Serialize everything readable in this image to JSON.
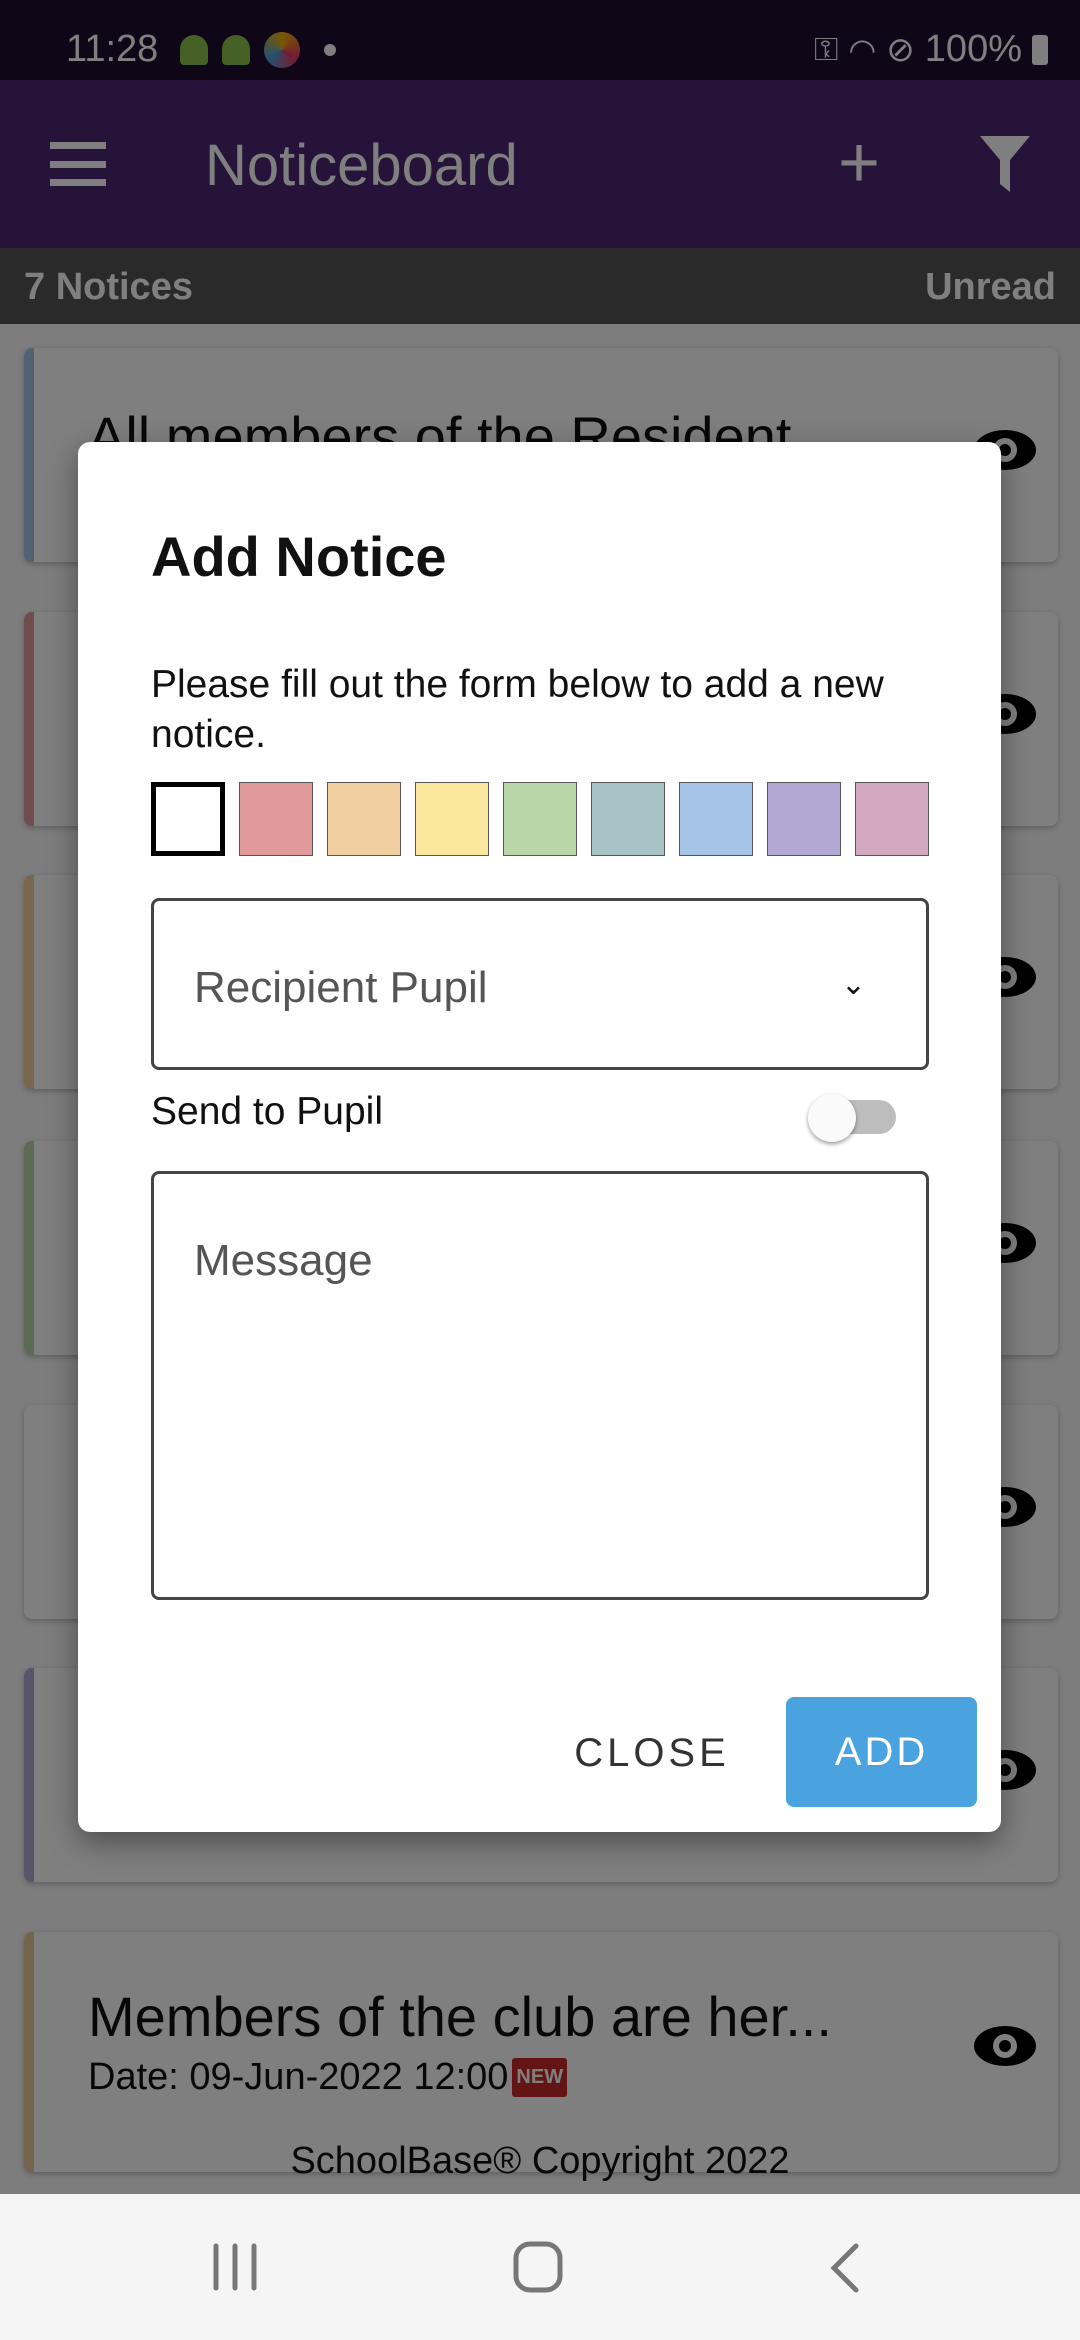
{
  "status_bar": {
    "time": "11:28",
    "battery": "100%"
  },
  "app_bar": {
    "title": "Noticeboard",
    "menu_icon": "hamburger-icon",
    "add_icon": "plus-icon",
    "filter_icon": "filter-icon",
    "color": "#4a2775"
  },
  "summary": {
    "count": "7 Notices",
    "filter": "Unread"
  },
  "notices": [
    {
      "title": "All members of the Resident",
      "color": "#a6c4e6"
    },
    {
      "title": "",
      "color": "#e09a9a"
    },
    {
      "title": "",
      "color": "#f2cfa0"
    },
    {
      "title": "",
      "color": "#b9d6a8"
    },
    {
      "title": "",
      "color": "#ffffff"
    },
    {
      "title": "",
      "color": "#b3a8d4"
    },
    {
      "title": "Members of the club are her...",
      "date": "Date: 09-Jun-2022 12:00",
      "badge": "NEW",
      "color": "#e8c898"
    }
  ],
  "footer": "SchoolBase® Copyright 2022",
  "dialog": {
    "title": "Add Notice",
    "description": "Please fill out the form below to add a new notice.",
    "colors": [
      "#ffffff",
      "#e09a9a",
      "#f2cfa0",
      "#fbe79e",
      "#b9d6a8",
      "#a8c3c6",
      "#a6c4e6",
      "#b3a8d4",
      "#d2a8c0"
    ],
    "selected_color": "#ffffff",
    "recipient_placeholder": "Recipient Pupil",
    "send_to_pupil_label": "Send to Pupil",
    "send_to_pupil": false,
    "message_placeholder": "Message",
    "close_label": "CLOSE",
    "add_label": "ADD",
    "add_color": "#4aa3df"
  }
}
